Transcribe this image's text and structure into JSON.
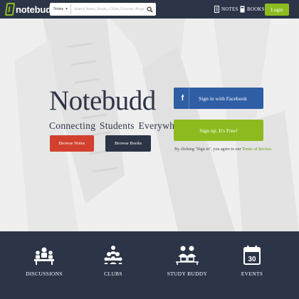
{
  "header": {
    "logo_text": "notebudd",
    "search": {
      "selected": "Notes",
      "placeholder": "Search Notes, Books, Clubs, Courses, Programs"
    },
    "nav": [
      {
        "label": "NOTES",
        "icon": "notes-icon"
      },
      {
        "label": "BOOKS",
        "icon": "books-icon"
      }
    ],
    "login_label": "Login"
  },
  "hero": {
    "title": "Notebudd",
    "tagline": "Connecting Students Everywhere",
    "browse_notes": "Browse Notes",
    "browse_books": "Browse Books",
    "facebook_icon": "f",
    "facebook_label": "Sign in with Facebook",
    "signup_label": "Sign up. It's Free!",
    "terms_prefix": "By clicking \"Sign in\", you agree to our ",
    "terms_link": "Terms of Service."
  },
  "features": [
    {
      "label": "DISCUSSIONS",
      "icon": "discussions-icon"
    },
    {
      "label": "CLUBS",
      "icon": "clubs-icon"
    },
    {
      "label": "STUDY BUDDY",
      "icon": "study-buddy-icon"
    },
    {
      "label": "EVENTS",
      "icon": "events-icon",
      "icon_text": "30"
    }
  ],
  "colors": {
    "navy": "#2c3447",
    "green": "#8dbb1f",
    "red": "#d2402e",
    "facebook": "#2f5ea5"
  }
}
